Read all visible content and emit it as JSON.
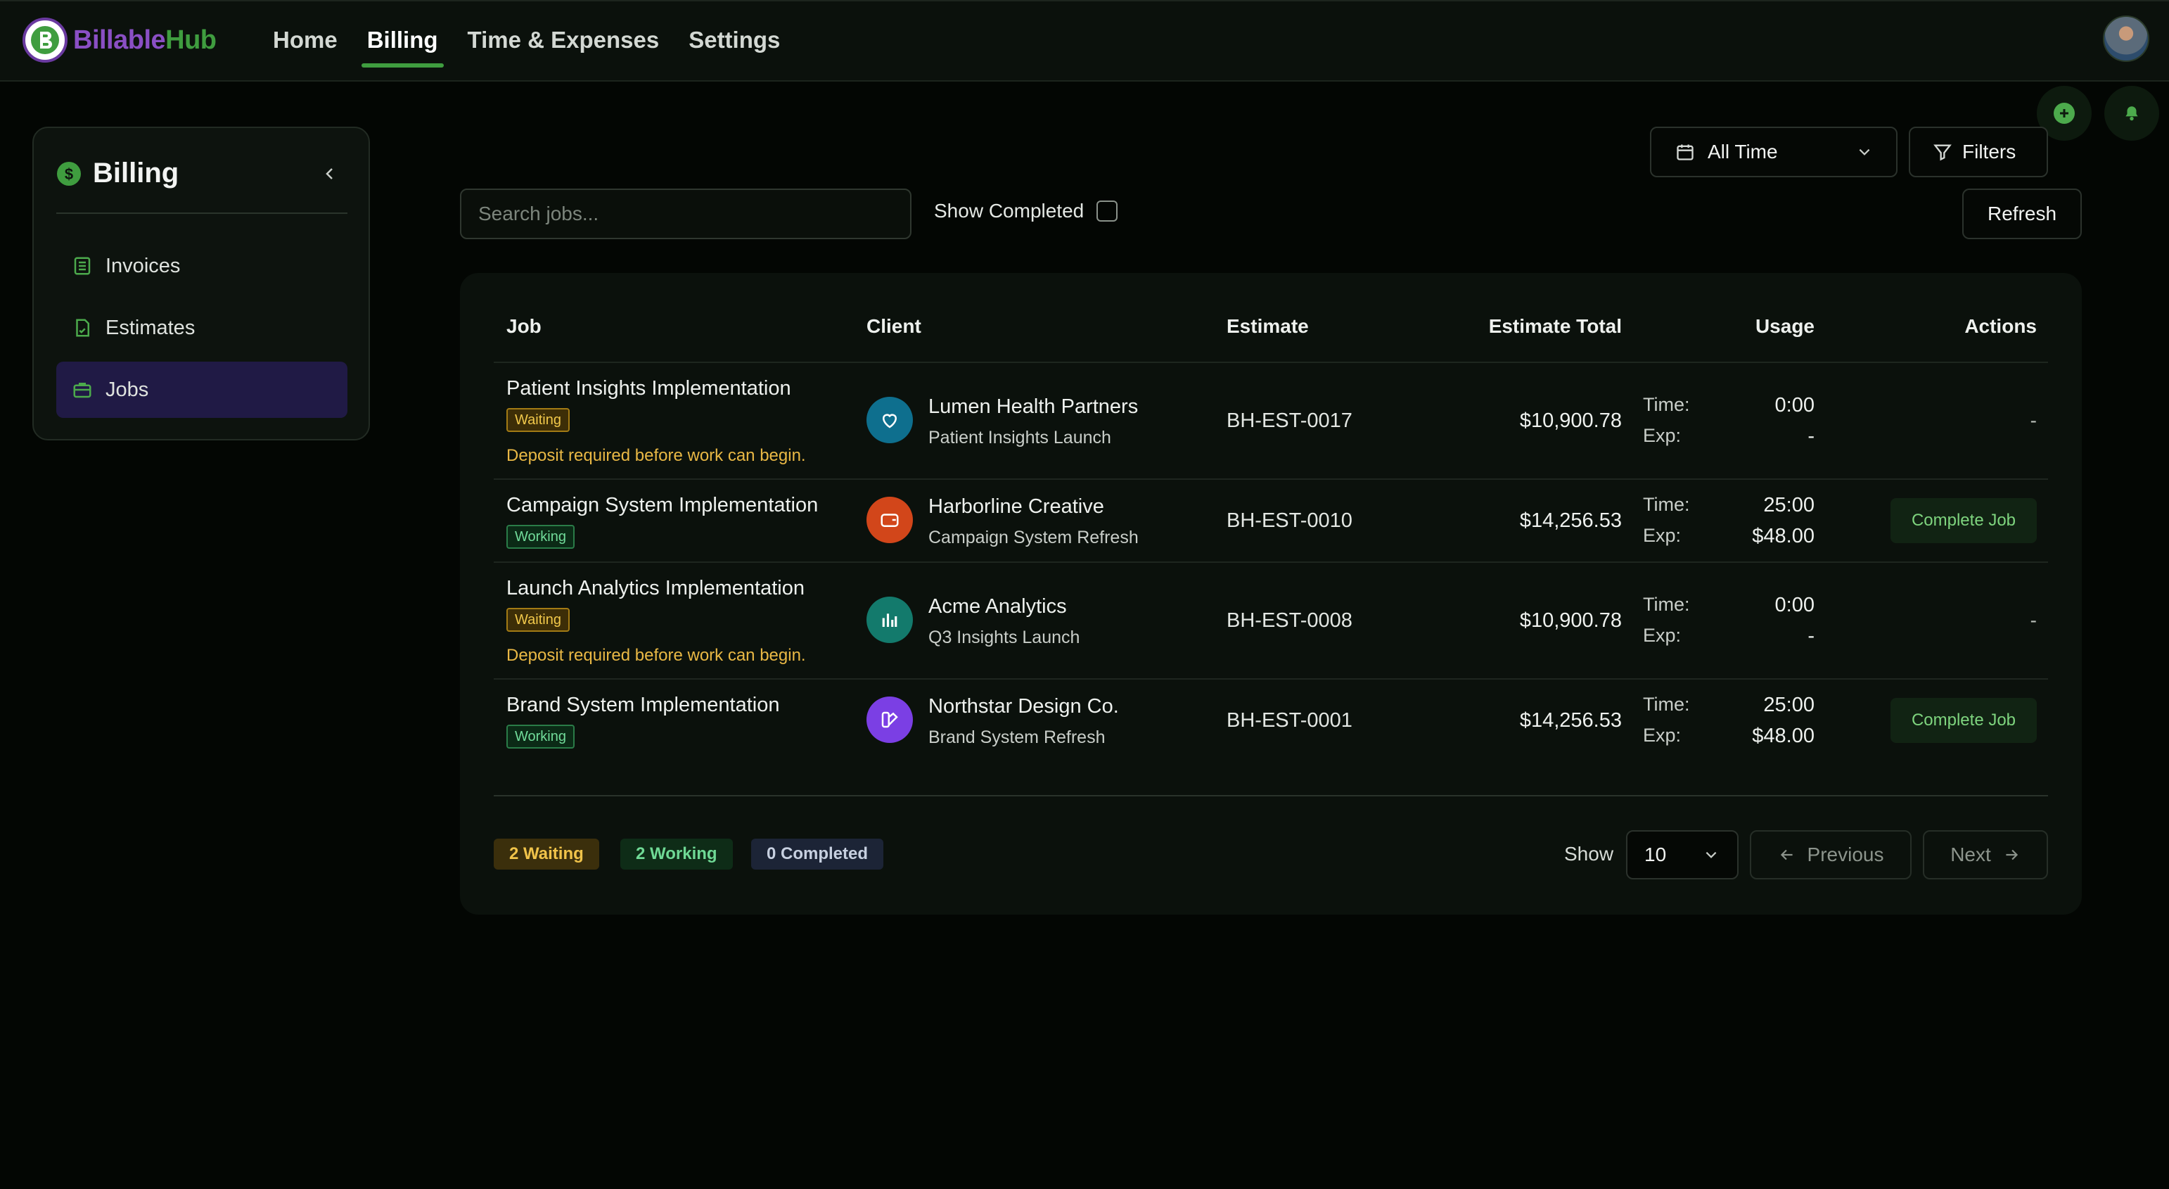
{
  "app": {
    "name_part1": "Billable",
    "name_part2": "Hub"
  },
  "nav": {
    "items": [
      "Home",
      "Billing",
      "Time & Expenses",
      "Settings"
    ],
    "active": "Billing"
  },
  "sidebar": {
    "title": "Billing",
    "items": [
      {
        "label": "Invoices",
        "icon": "list-icon"
      },
      {
        "label": "Estimates",
        "icon": "document-icon"
      },
      {
        "label": "Jobs",
        "icon": "briefcase-icon"
      }
    ],
    "active": "Jobs"
  },
  "toolbar": {
    "date_range": "All Time",
    "filters_label": "Filters",
    "search_placeholder": "Search jobs...",
    "show_completed_label": "Show Completed",
    "refresh_label": "Refresh"
  },
  "table": {
    "headers": [
      "Job",
      "Client",
      "Estimate",
      "Estimate Total",
      "Usage",
      "Actions"
    ],
    "usage_time_label": "Time:",
    "usage_exp_label": "Exp:",
    "rows": [
      {
        "job": "Patient Insights Implementation",
        "status": "Waiting",
        "note": "Deposit required before work can begin.",
        "client": "Lumen Health Partners",
        "client_sub": "Patient Insights Launch",
        "client_icon": "heart-icon",
        "client_color": "#0e6f8e",
        "estimate": "BH-EST-0017",
        "total": "$10,900.78",
        "time": "0:00",
        "exp": "-",
        "action": "-"
      },
      {
        "job": "Campaign System Implementation",
        "status": "Working",
        "note": "",
        "client": "Harborline Creative",
        "client_sub": "Campaign System Refresh",
        "client_icon": "wallet-icon",
        "client_color": "#d2461a",
        "estimate": "BH-EST-0010",
        "total": "$14,256.53",
        "time": "25:00",
        "exp": "$48.00",
        "action": "Complete Job"
      },
      {
        "job": "Launch Analytics Implementation",
        "status": "Waiting",
        "note": "Deposit required before work can begin.",
        "client": "Acme Analytics",
        "client_sub": "Q3 Insights Launch",
        "client_icon": "bar-chart-icon",
        "client_color": "#137a6c",
        "estimate": "BH-EST-0008",
        "total": "$10,900.78",
        "time": "0:00",
        "exp": "-",
        "action": "-"
      },
      {
        "job": "Brand System Implementation",
        "status": "Working",
        "note": "",
        "client": "Northstar Design Co.",
        "client_sub": "Brand System Refresh",
        "client_icon": "palette-icon",
        "client_color": "#7b3fe4",
        "estimate": "BH-EST-0001",
        "total": "$14,256.53",
        "time": "25:00",
        "exp": "$48.00",
        "action": "Complete Job"
      }
    ]
  },
  "summary": {
    "waiting": "2 Waiting",
    "working": "2 Working",
    "completed": "0 Completed"
  },
  "pagination": {
    "show_label": "Show",
    "page_size": "10",
    "previous": "Previous",
    "next": "Next"
  },
  "colors": {
    "accent": "#3f9d3f",
    "active_nav_bg": "#201a45",
    "waiting": "#f1c84a",
    "working": "#71dc9a"
  }
}
